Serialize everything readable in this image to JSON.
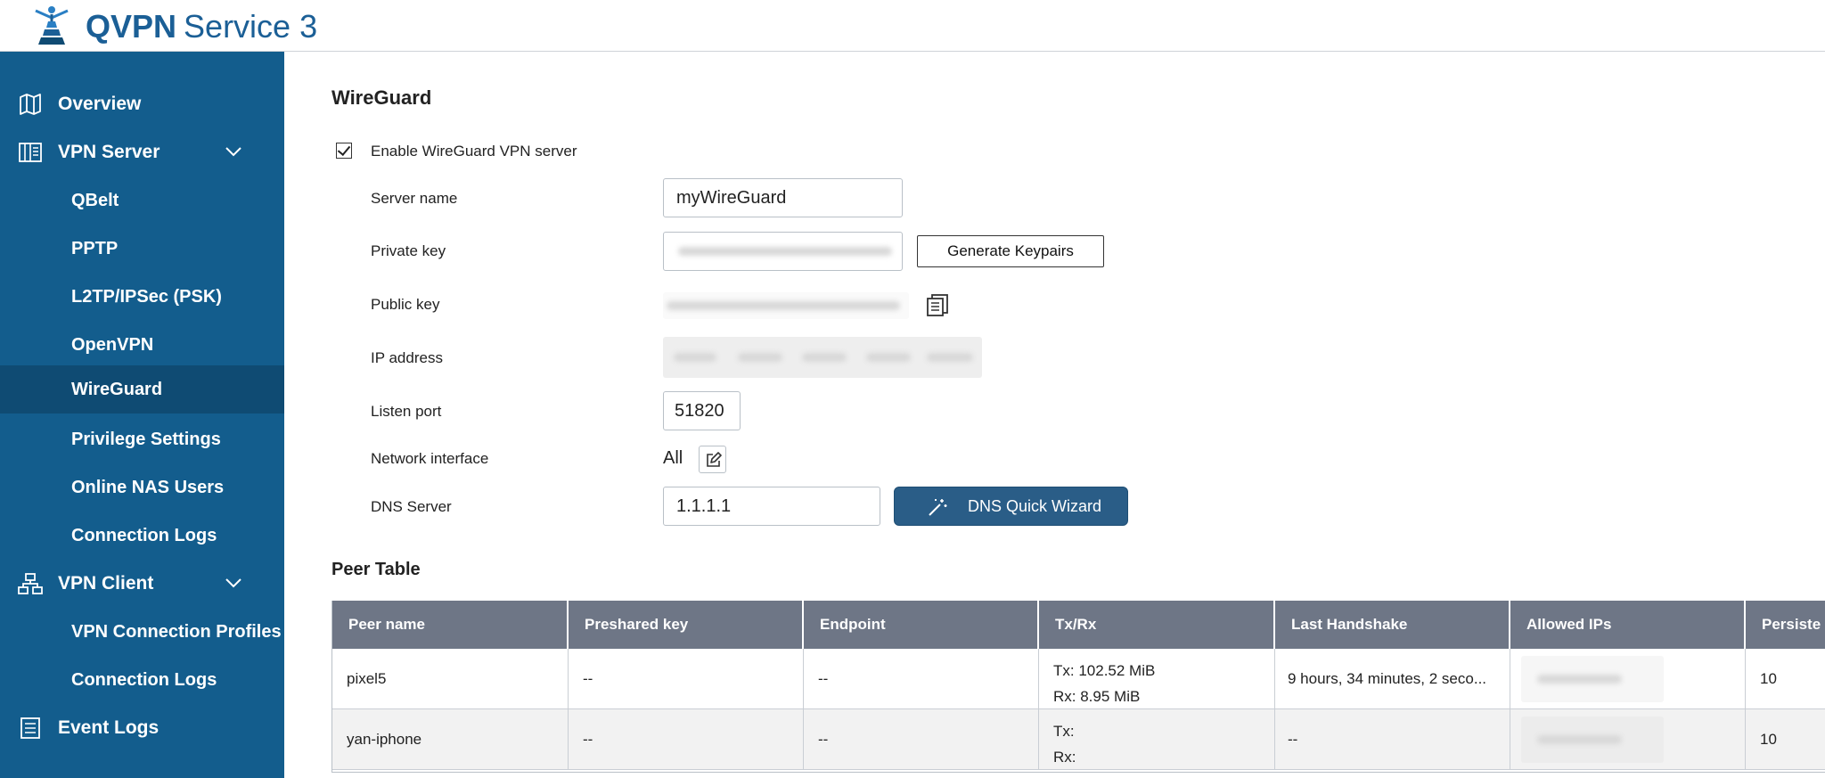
{
  "header": {
    "brand": "QVPN",
    "title_rest": "Service 3"
  },
  "sidebar": {
    "overview": "Overview",
    "vpn_server": "VPN Server",
    "server_items": [
      "QBelt",
      "PPTP",
      "L2TP/IPSec (PSK)",
      "OpenVPN",
      "WireGuard",
      "Privilege Settings",
      "Online NAS Users",
      "Connection Logs"
    ],
    "vpn_client": "VPN Client",
    "client_items": [
      "VPN Connection Profiles",
      "Connection Logs"
    ],
    "event_logs": "Event Logs",
    "active_item": "WireGuard"
  },
  "wireguard": {
    "title": "WireGuard",
    "enable_label": "Enable WireGuard VPN server",
    "enable_checked": true,
    "server_name_label": "Server name",
    "server_name": "myWireGuard",
    "private_key_label": "Private key",
    "generate_button": "Generate Keypairs",
    "public_key_label": "Public key",
    "ip_address_label": "IP address",
    "listen_port_label": "Listen port",
    "listen_port": "51820",
    "network_interface_label": "Network interface",
    "network_interface": "All",
    "dns_server_label": "DNS Server",
    "dns_server": "1.1.1.1",
    "dns_wizard_button": "DNS Quick Wizard"
  },
  "peer_table": {
    "title": "Peer Table",
    "columns": [
      "Peer name",
      "Preshared key",
      "Endpoint",
      "Tx/Rx",
      "Last Handshake",
      "Allowed IPs",
      "Persiste"
    ],
    "rows": [
      {
        "peer_name": "pixel5",
        "preshared_key": "--",
        "endpoint": "--",
        "tx": "Tx: 102.52 MiB",
        "rx": "Rx: 8.95 MiB",
        "last_handshake": "9 hours, 34 minutes, 2 seco...",
        "persistent": "10"
      },
      {
        "peer_name": "yan-iphone",
        "preshared_key": "--",
        "endpoint": "--",
        "tx": "Tx:",
        "rx": "Rx:",
        "last_handshake": "--",
        "persistent": "10"
      }
    ]
  },
  "colors": {
    "sidebar": "#135d8d",
    "sidebar_active": "#0f4b73",
    "brand": "#1b5f96",
    "table_header": "#6e7686",
    "primary_button": "#2a5d87"
  }
}
